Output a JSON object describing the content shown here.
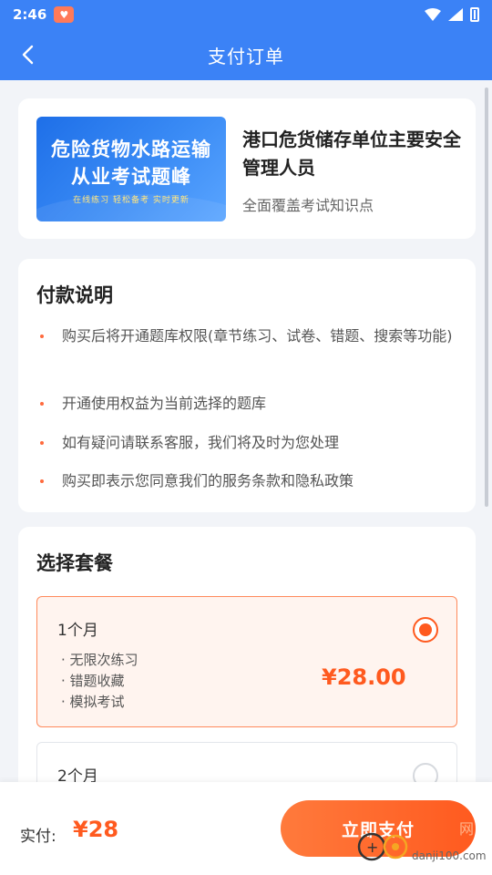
{
  "status_bar": {
    "time": "2:46"
  },
  "navbar": {
    "title": "支付订单"
  },
  "product": {
    "cover_line1": "危险货物水路运输",
    "cover_line2": "从业考试题峰",
    "cover_tagline": "在线练习 轻松备考 实时更新",
    "title": "港口危货储存单位主要安全管理人员",
    "subtitle": "全面覆盖考试知识点"
  },
  "payment_notes": {
    "title": "付款说明",
    "items": [
      "购买后将开通题库权限(章节练习、试卷、错题、搜索等功能)",
      "开通使用权益为当前选择的题库",
      "如有疑问请联系客服，我们将及时为您处理",
      "购买即表示您同意我们的服务条款和隐私政策"
    ]
  },
  "plans": {
    "title": "选择套餐",
    "options": [
      {
        "name": "1个月",
        "features": [
          "无限次练习",
          "错题收藏",
          "模拟考试"
        ],
        "price": "¥28.00",
        "selected": true
      },
      {
        "name": "2个月",
        "selected": false
      }
    ]
  },
  "bottom": {
    "pay_label": "实付:",
    "amount": "¥28",
    "pay_button": "立即支付"
  },
  "watermark": {
    "text1": "网",
    "text2": "danji100.com"
  },
  "colors": {
    "primary": "#3b82f6",
    "accent": "#ff5a1f",
    "background": "#f2f4f8"
  }
}
